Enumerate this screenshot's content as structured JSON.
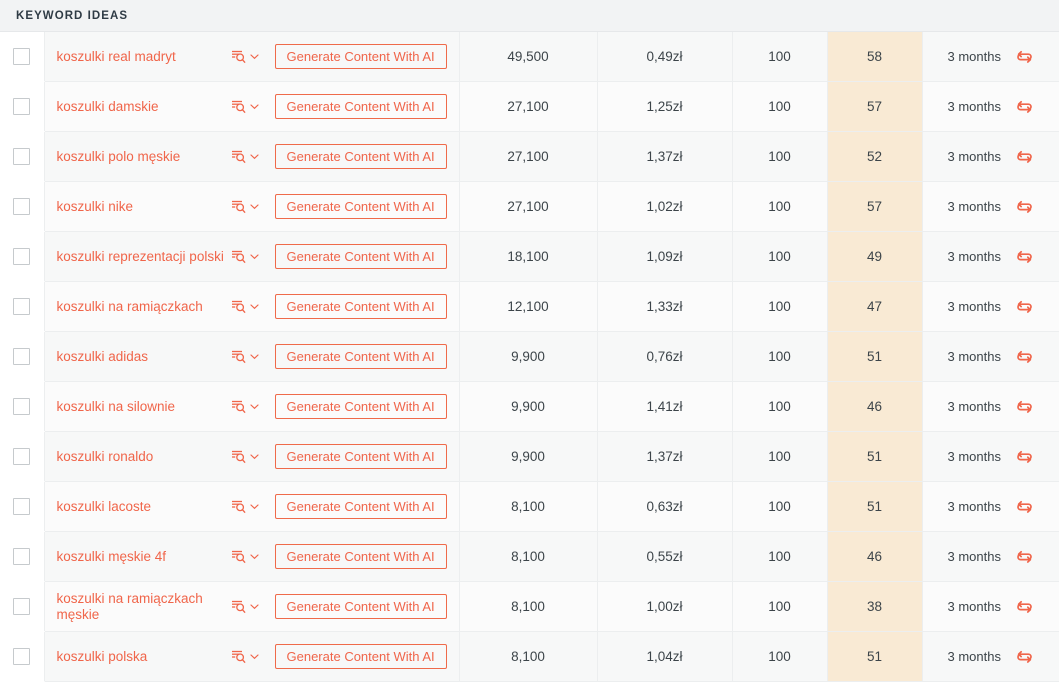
{
  "panel": {
    "title": "KEYWORD IDEAS"
  },
  "colors": {
    "accent": "#f0654a",
    "button_border": "#ef6a4a",
    "kd_column_highlight": "#f9ead4",
    "header_bg": "#f2f3f4",
    "row_odd_bg": "#f7f8f8",
    "row_even_bg": "#fbfbfb",
    "text": "#3c4449"
  },
  "icons": {
    "serp_analysis": "serp-analysis-icon",
    "chevron_down": "chevron-down-icon",
    "refresh": "refresh-icon",
    "checkbox": "row-checkbox"
  },
  "actions": {
    "generate_label": "Generate Content With AI"
  },
  "rows": [
    {
      "keyword": "koszulki real madryt",
      "volume": "49,500",
      "cpc": "0,49zł",
      "competition": "100",
      "kd": "58",
      "updated": "3 months"
    },
    {
      "keyword": "koszulki damskie",
      "volume": "27,100",
      "cpc": "1,25zł",
      "competition": "100",
      "kd": "57",
      "updated": "3 months"
    },
    {
      "keyword": "koszulki polo męskie",
      "volume": "27,100",
      "cpc": "1,37zł",
      "competition": "100",
      "kd": "52",
      "updated": "3 months"
    },
    {
      "keyword": "koszulki nike",
      "volume": "27,100",
      "cpc": "1,02zł",
      "competition": "100",
      "kd": "57",
      "updated": "3 months"
    },
    {
      "keyword": "koszulki reprezentacji polski",
      "volume": "18,100",
      "cpc": "1,09zł",
      "competition": "100",
      "kd": "49",
      "updated": "3 months"
    },
    {
      "keyword": "koszulki na ramiączkach",
      "volume": "12,100",
      "cpc": "1,33zł",
      "competition": "100",
      "kd": "47",
      "updated": "3 months"
    },
    {
      "keyword": "koszulki adidas",
      "volume": "9,900",
      "cpc": "0,76zł",
      "competition": "100",
      "kd": "51",
      "updated": "3 months"
    },
    {
      "keyword": "koszulki na silownie",
      "volume": "9,900",
      "cpc": "1,41zł",
      "competition": "100",
      "kd": "46",
      "updated": "3 months"
    },
    {
      "keyword": "koszulki ronaldo",
      "volume": "9,900",
      "cpc": "1,37zł",
      "competition": "100",
      "kd": "51",
      "updated": "3 months"
    },
    {
      "keyword": "koszulki lacoste",
      "volume": "8,100",
      "cpc": "0,63zł",
      "competition": "100",
      "kd": "51",
      "updated": "3 months"
    },
    {
      "keyword": "koszulki męskie 4f",
      "volume": "8,100",
      "cpc": "0,55zł",
      "competition": "100",
      "kd": "46",
      "updated": "3 months"
    },
    {
      "keyword": "koszulki na ramiączkach męskie",
      "volume": "8,100",
      "cpc": "1,00zł",
      "competition": "100",
      "kd": "38",
      "updated": "3 months"
    },
    {
      "keyword": "koszulki polska",
      "volume": "8,100",
      "cpc": "1,04zł",
      "competition": "100",
      "kd": "51",
      "updated": "3 months"
    }
  ]
}
